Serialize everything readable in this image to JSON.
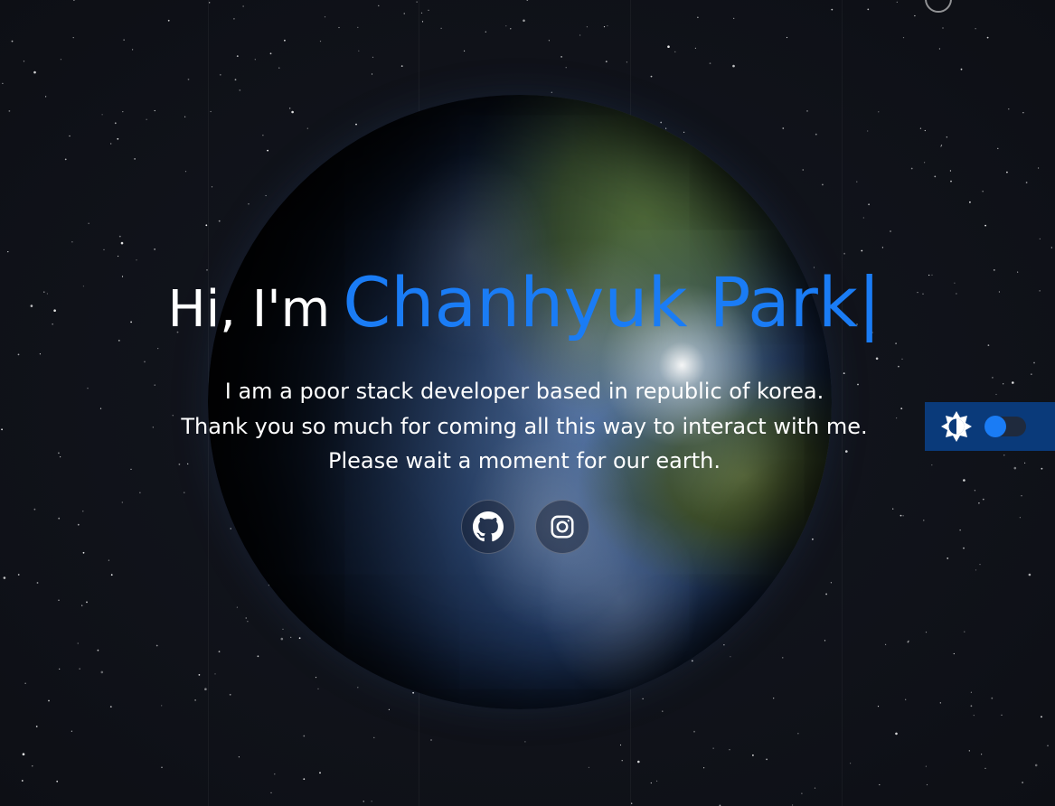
{
  "hero": {
    "greeting": "Hi, I'm",
    "name": "Chanhyuk Park",
    "cursor": "|",
    "lines": [
      "I am a poor stack developer based in republic of korea.",
      "Thank you so much for coming all this way to interact with me.",
      "Please wait a moment for our earth."
    ]
  },
  "socials": [
    {
      "icon": "github-icon"
    },
    {
      "icon": "instagram-icon"
    }
  ],
  "theme_toggle": {
    "icon": "brightness-icon",
    "state": "off"
  },
  "colors": {
    "background": "#0f1118",
    "accent": "#1a7cf5",
    "text": "#ffffff",
    "toggle_panel": "#0a3a7a"
  }
}
